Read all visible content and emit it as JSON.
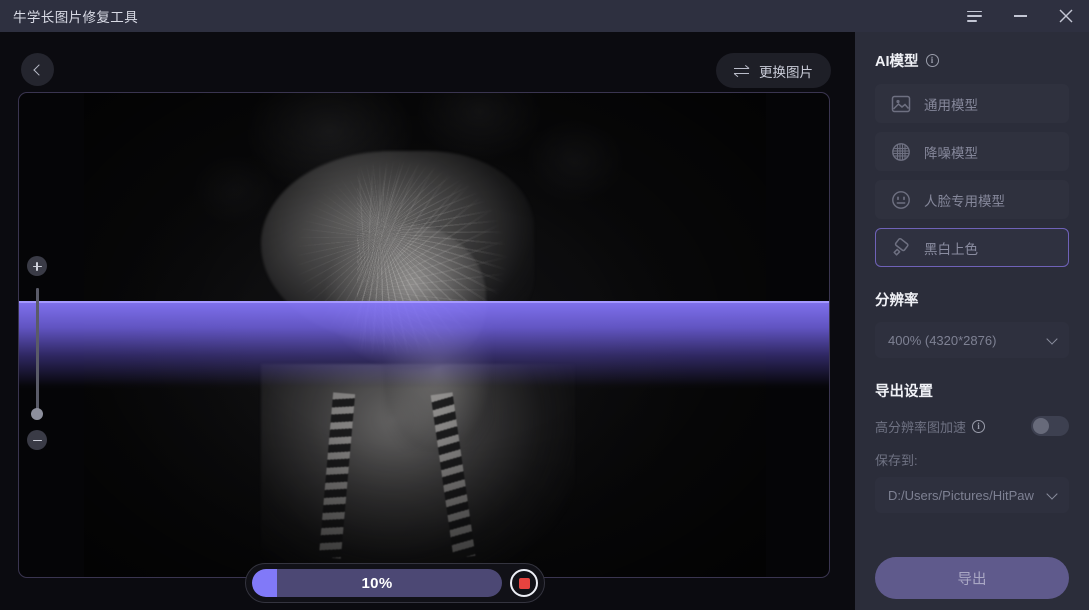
{
  "window": {
    "title": "牛学长图片修复工具",
    "controls": [
      {
        "name": "menu-button",
        "icon": "hamburger-icon"
      },
      {
        "name": "minimize-button",
        "icon": "minimize-icon"
      },
      {
        "name": "close-button",
        "icon": "close-icon",
        "glyph": "✕"
      }
    ]
  },
  "toolbar": {
    "back_icon": "chevron-left-icon",
    "replace_label": "更换图片",
    "replace_icon": "swap-arrows-icon"
  },
  "canvas": {
    "zoom_in_icon": "plus-icon",
    "zoom_out_icon": "minus-icon",
    "image_description": "黑白人像照片",
    "scan_overlay_color": "#8576f8"
  },
  "progress": {
    "percent": 10,
    "percent_label": "10%",
    "fill_color": "#8179f8",
    "track_color": "#4c4874",
    "stop_icon": "stop-square-icon",
    "stop_color": "#e8433f"
  },
  "panel": {
    "ai_model": {
      "title": "AI模型",
      "info_icon": "info-icon",
      "info_glyph": "i",
      "items": [
        {
          "label": "通用模型",
          "icon": "picture-icon",
          "selected": false
        },
        {
          "label": "降噪模型",
          "icon": "denoise-mesh-icon",
          "selected": false
        },
        {
          "label": "人脸专用模型",
          "icon": "face-icon",
          "selected": false
        },
        {
          "label": "黑白上色",
          "icon": "paint-roller-icon",
          "selected": true
        }
      ],
      "selected_border_color": "#6f62b8"
    },
    "resolution": {
      "title": "分辨率",
      "value": "400% (4320*2876)",
      "chevron_icon": "chevron-down-icon"
    },
    "export_settings": {
      "title": "导出设置",
      "accelerate_label": "高分辨率图加速",
      "accelerate_info_icon": "info-icon",
      "accelerate_info_glyph": "i",
      "accelerate_enabled": false,
      "save_to_label": "保存到:",
      "save_to_value": "D:/Users/Pictures/HitPaw",
      "save_chevron_icon": "chevron-down-icon"
    },
    "export_button": {
      "label": "导出",
      "color": "#5f5a8c"
    }
  }
}
